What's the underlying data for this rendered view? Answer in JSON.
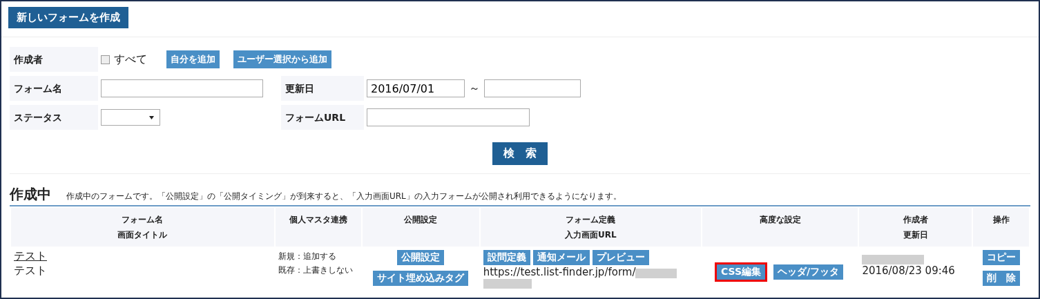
{
  "new_form_button": "新しいフォームを作成",
  "filters": {
    "author": {
      "label": "作成者",
      "all_checkbox": {
        "label": "すべて",
        "checked": false
      },
      "buttons": [
        "自分を追加",
        "ユーザー選択から追加"
      ]
    },
    "form_name": {
      "label": "フォーム名"
    },
    "updated": {
      "label": "更新日",
      "from": "2016/07/01",
      "separator": "～"
    },
    "status": {
      "label": "ステータス"
    },
    "form_url": {
      "label": "フォームURL"
    },
    "search_button": "検　索"
  },
  "section": {
    "title": "作成中",
    "description": "作成中のフォームです。「公開設定」の「公開タイミング」が到来すると、「入力画面URL」の入力フォームが公開され利用できるようになります。"
  },
  "table": {
    "columns": [
      [
        "フォーム名",
        "画面タイトル"
      ],
      [
        "個人マスタ連携"
      ],
      [
        "公開設定"
      ],
      [
        "フォーム定義",
        "入力画面URL"
      ],
      [
        "高度な設定"
      ],
      [
        "作成者",
        "更新日"
      ],
      [
        "操作"
      ]
    ],
    "rows": [
      {
        "form_name": "テスト",
        "screen_title": "テスト",
        "master_link": [
          "新規：追加する",
          "既存：上書きしない"
        ],
        "publish_buttons": [
          "公開設定",
          "サイト埋め込みタグ"
        ],
        "definition_buttons": [
          "設問定義",
          "通知メール",
          "プレビュー"
        ],
        "url": "https://test.list-finder.jp/form/",
        "advanced_buttons": [
          {
            "label": "CSS編集",
            "highlighted": true
          },
          {
            "label": "ヘッダ/フッタ",
            "highlighted": false
          }
        ],
        "updated": "2016/08/23 09:46",
        "actions": [
          "コピー",
          "削　除"
        ]
      }
    ]
  }
}
